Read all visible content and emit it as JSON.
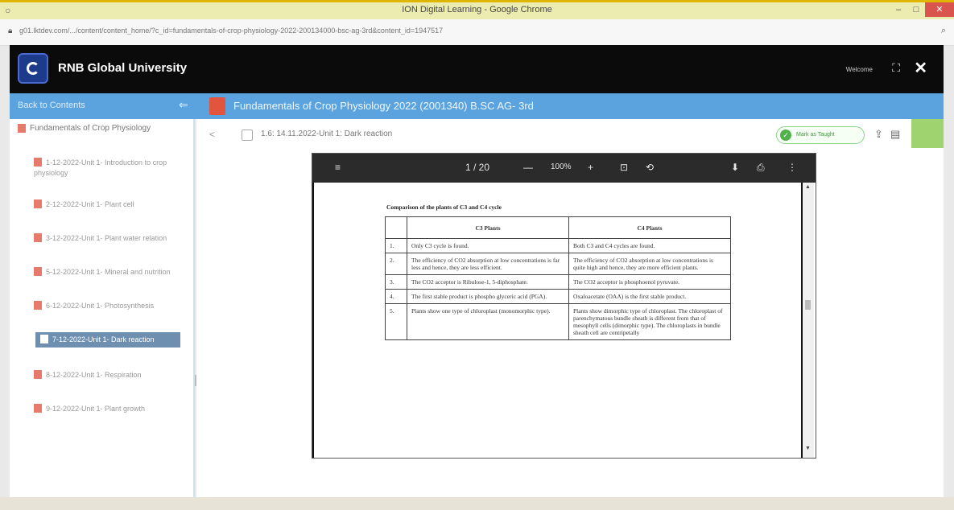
{
  "window": {
    "title": "ION Digital Learning - Google Chrome",
    "url": "g01.lktdev.com/.../content/content_home/?c_id=fundamentals-of-crop-physiology-2022-200134000-bsc-ag-3rd&content_id=1947517",
    "controls": {
      "minimize": "–",
      "maximize": "□",
      "close": "✕"
    }
  },
  "header": {
    "brand": "RNB Global University",
    "user": "Welcome",
    "close_label": "✕",
    "expand_label": "⛶"
  },
  "course_bar": {
    "back_label": "Back to Contents",
    "back_arrow": "⇐",
    "title": "Fundamentals of Crop Physiology 2022 (2001340) B.SC AG- 3rd"
  },
  "sidebar": {
    "root": "Fundamentals of Crop Physiology",
    "items": [
      {
        "label": "1-12-2022-Unit 1- Introduction to crop physiology"
      },
      {
        "label": "2-12-2022-Unit 1- Plant cell"
      },
      {
        "label": "3-12-2022-Unit 1- Plant water relation"
      },
      {
        "label": "5-12-2022-Unit 1- Mineral and nutrition"
      },
      {
        "label": "6-12-2022-Unit 1- Photosynthesis"
      },
      {
        "label": "7-12-2022-Unit 1- Dark reaction"
      },
      {
        "label": "8-12-2022-Unit 1- Respiration"
      },
      {
        "label": "9-12-2022-Unit 1- Plant growth"
      }
    ]
  },
  "lesson": {
    "title": "1.6: 14.11.2022-Unit 1: Dark reaction",
    "prev": "<",
    "mark_label": "Mark as Taught"
  },
  "pdf": {
    "toolbar": {
      "menu": "≡",
      "page": "1 / 20",
      "minus": "—",
      "zoom": "100%",
      "plus": "+",
      "fit": "⊡",
      "rotate": "⟲",
      "download": "⬇",
      "print": "⎙",
      "more": "⋮"
    },
    "heading": "Comparison of the plants of C3 and C4 cycle",
    "table": {
      "headers": [
        "",
        "C3 Plants",
        "C4 Plants"
      ],
      "rows": [
        [
          "1.",
          "Only C3 cycle is found.",
          "Both C3 and C4 cycles are found."
        ],
        [
          "2.",
          "The efficiency of CO2 absorption at low concentrations is far less and hence, they are less efficient.",
          "The efficiency of CO2 absorption at low concentrations is quite high and hence, they are more efficient plants."
        ],
        [
          "3.",
          "The CO2 acceptor is Ribulose-1, 5-diphosphate.",
          "The CO2 acceptor is phosphoenol pyruvate."
        ],
        [
          "4.",
          "The first stable product is phospho glyceric acid (PGA).",
          "Oxaloacetate (OAA) is the first stable product."
        ],
        [
          "5.",
          "Plants show one type of chloroplast (monomorphic type).",
          "Plants show dimorphic type of chloroplast. The chloroplast of parenchymatous bundle sheath is different from that of mesophyll cells (dimorphic type). The chloroplasts in bundle sheath cell are centripetally"
        ]
      ]
    }
  }
}
